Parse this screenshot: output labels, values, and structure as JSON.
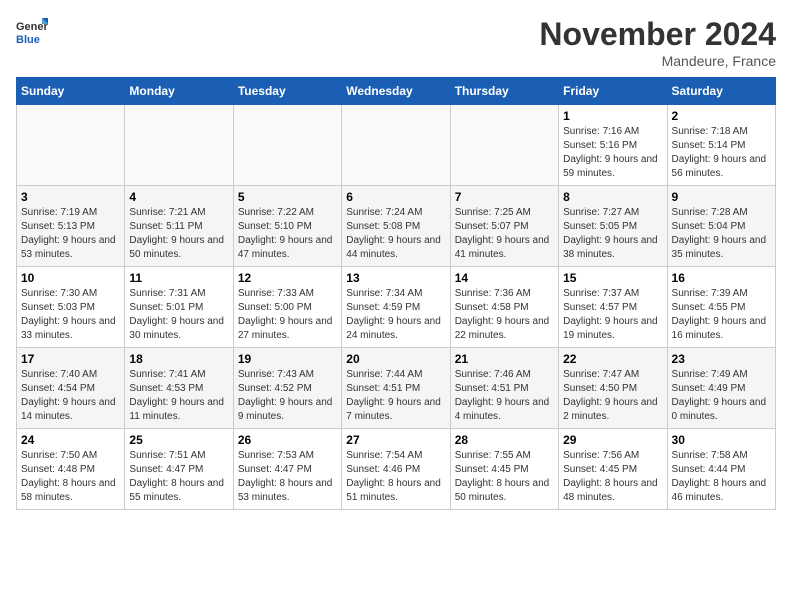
{
  "logo": {
    "line1": "General",
    "line2": "Blue"
  },
  "title": "November 2024",
  "location": "Mandeure, France",
  "days_of_week": [
    "Sunday",
    "Monday",
    "Tuesday",
    "Wednesday",
    "Thursday",
    "Friday",
    "Saturday"
  ],
  "weeks": [
    [
      {
        "day": "",
        "info": ""
      },
      {
        "day": "",
        "info": ""
      },
      {
        "day": "",
        "info": ""
      },
      {
        "day": "",
        "info": ""
      },
      {
        "day": "",
        "info": ""
      },
      {
        "day": "1",
        "info": "Sunrise: 7:16 AM\nSunset: 5:16 PM\nDaylight: 9 hours and 59 minutes."
      },
      {
        "day": "2",
        "info": "Sunrise: 7:18 AM\nSunset: 5:14 PM\nDaylight: 9 hours and 56 minutes."
      }
    ],
    [
      {
        "day": "3",
        "info": "Sunrise: 7:19 AM\nSunset: 5:13 PM\nDaylight: 9 hours and 53 minutes."
      },
      {
        "day": "4",
        "info": "Sunrise: 7:21 AM\nSunset: 5:11 PM\nDaylight: 9 hours and 50 minutes."
      },
      {
        "day": "5",
        "info": "Sunrise: 7:22 AM\nSunset: 5:10 PM\nDaylight: 9 hours and 47 minutes."
      },
      {
        "day": "6",
        "info": "Sunrise: 7:24 AM\nSunset: 5:08 PM\nDaylight: 9 hours and 44 minutes."
      },
      {
        "day": "7",
        "info": "Sunrise: 7:25 AM\nSunset: 5:07 PM\nDaylight: 9 hours and 41 minutes."
      },
      {
        "day": "8",
        "info": "Sunrise: 7:27 AM\nSunset: 5:05 PM\nDaylight: 9 hours and 38 minutes."
      },
      {
        "day": "9",
        "info": "Sunrise: 7:28 AM\nSunset: 5:04 PM\nDaylight: 9 hours and 35 minutes."
      }
    ],
    [
      {
        "day": "10",
        "info": "Sunrise: 7:30 AM\nSunset: 5:03 PM\nDaylight: 9 hours and 33 minutes."
      },
      {
        "day": "11",
        "info": "Sunrise: 7:31 AM\nSunset: 5:01 PM\nDaylight: 9 hours and 30 minutes."
      },
      {
        "day": "12",
        "info": "Sunrise: 7:33 AM\nSunset: 5:00 PM\nDaylight: 9 hours and 27 minutes."
      },
      {
        "day": "13",
        "info": "Sunrise: 7:34 AM\nSunset: 4:59 PM\nDaylight: 9 hours and 24 minutes."
      },
      {
        "day": "14",
        "info": "Sunrise: 7:36 AM\nSunset: 4:58 PM\nDaylight: 9 hours and 22 minutes."
      },
      {
        "day": "15",
        "info": "Sunrise: 7:37 AM\nSunset: 4:57 PM\nDaylight: 9 hours and 19 minutes."
      },
      {
        "day": "16",
        "info": "Sunrise: 7:39 AM\nSunset: 4:55 PM\nDaylight: 9 hours and 16 minutes."
      }
    ],
    [
      {
        "day": "17",
        "info": "Sunrise: 7:40 AM\nSunset: 4:54 PM\nDaylight: 9 hours and 14 minutes."
      },
      {
        "day": "18",
        "info": "Sunrise: 7:41 AM\nSunset: 4:53 PM\nDaylight: 9 hours and 11 minutes."
      },
      {
        "day": "19",
        "info": "Sunrise: 7:43 AM\nSunset: 4:52 PM\nDaylight: 9 hours and 9 minutes."
      },
      {
        "day": "20",
        "info": "Sunrise: 7:44 AM\nSunset: 4:51 PM\nDaylight: 9 hours and 7 minutes."
      },
      {
        "day": "21",
        "info": "Sunrise: 7:46 AM\nSunset: 4:51 PM\nDaylight: 9 hours and 4 minutes."
      },
      {
        "day": "22",
        "info": "Sunrise: 7:47 AM\nSunset: 4:50 PM\nDaylight: 9 hours and 2 minutes."
      },
      {
        "day": "23",
        "info": "Sunrise: 7:49 AM\nSunset: 4:49 PM\nDaylight: 9 hours and 0 minutes."
      }
    ],
    [
      {
        "day": "24",
        "info": "Sunrise: 7:50 AM\nSunset: 4:48 PM\nDaylight: 8 hours and 58 minutes."
      },
      {
        "day": "25",
        "info": "Sunrise: 7:51 AM\nSunset: 4:47 PM\nDaylight: 8 hours and 55 minutes."
      },
      {
        "day": "26",
        "info": "Sunrise: 7:53 AM\nSunset: 4:47 PM\nDaylight: 8 hours and 53 minutes."
      },
      {
        "day": "27",
        "info": "Sunrise: 7:54 AM\nSunset: 4:46 PM\nDaylight: 8 hours and 51 minutes."
      },
      {
        "day": "28",
        "info": "Sunrise: 7:55 AM\nSunset: 4:45 PM\nDaylight: 8 hours and 50 minutes."
      },
      {
        "day": "29",
        "info": "Sunrise: 7:56 AM\nSunset: 4:45 PM\nDaylight: 8 hours and 48 minutes."
      },
      {
        "day": "30",
        "info": "Sunrise: 7:58 AM\nSunset: 4:44 PM\nDaylight: 8 hours and 46 minutes."
      }
    ]
  ]
}
